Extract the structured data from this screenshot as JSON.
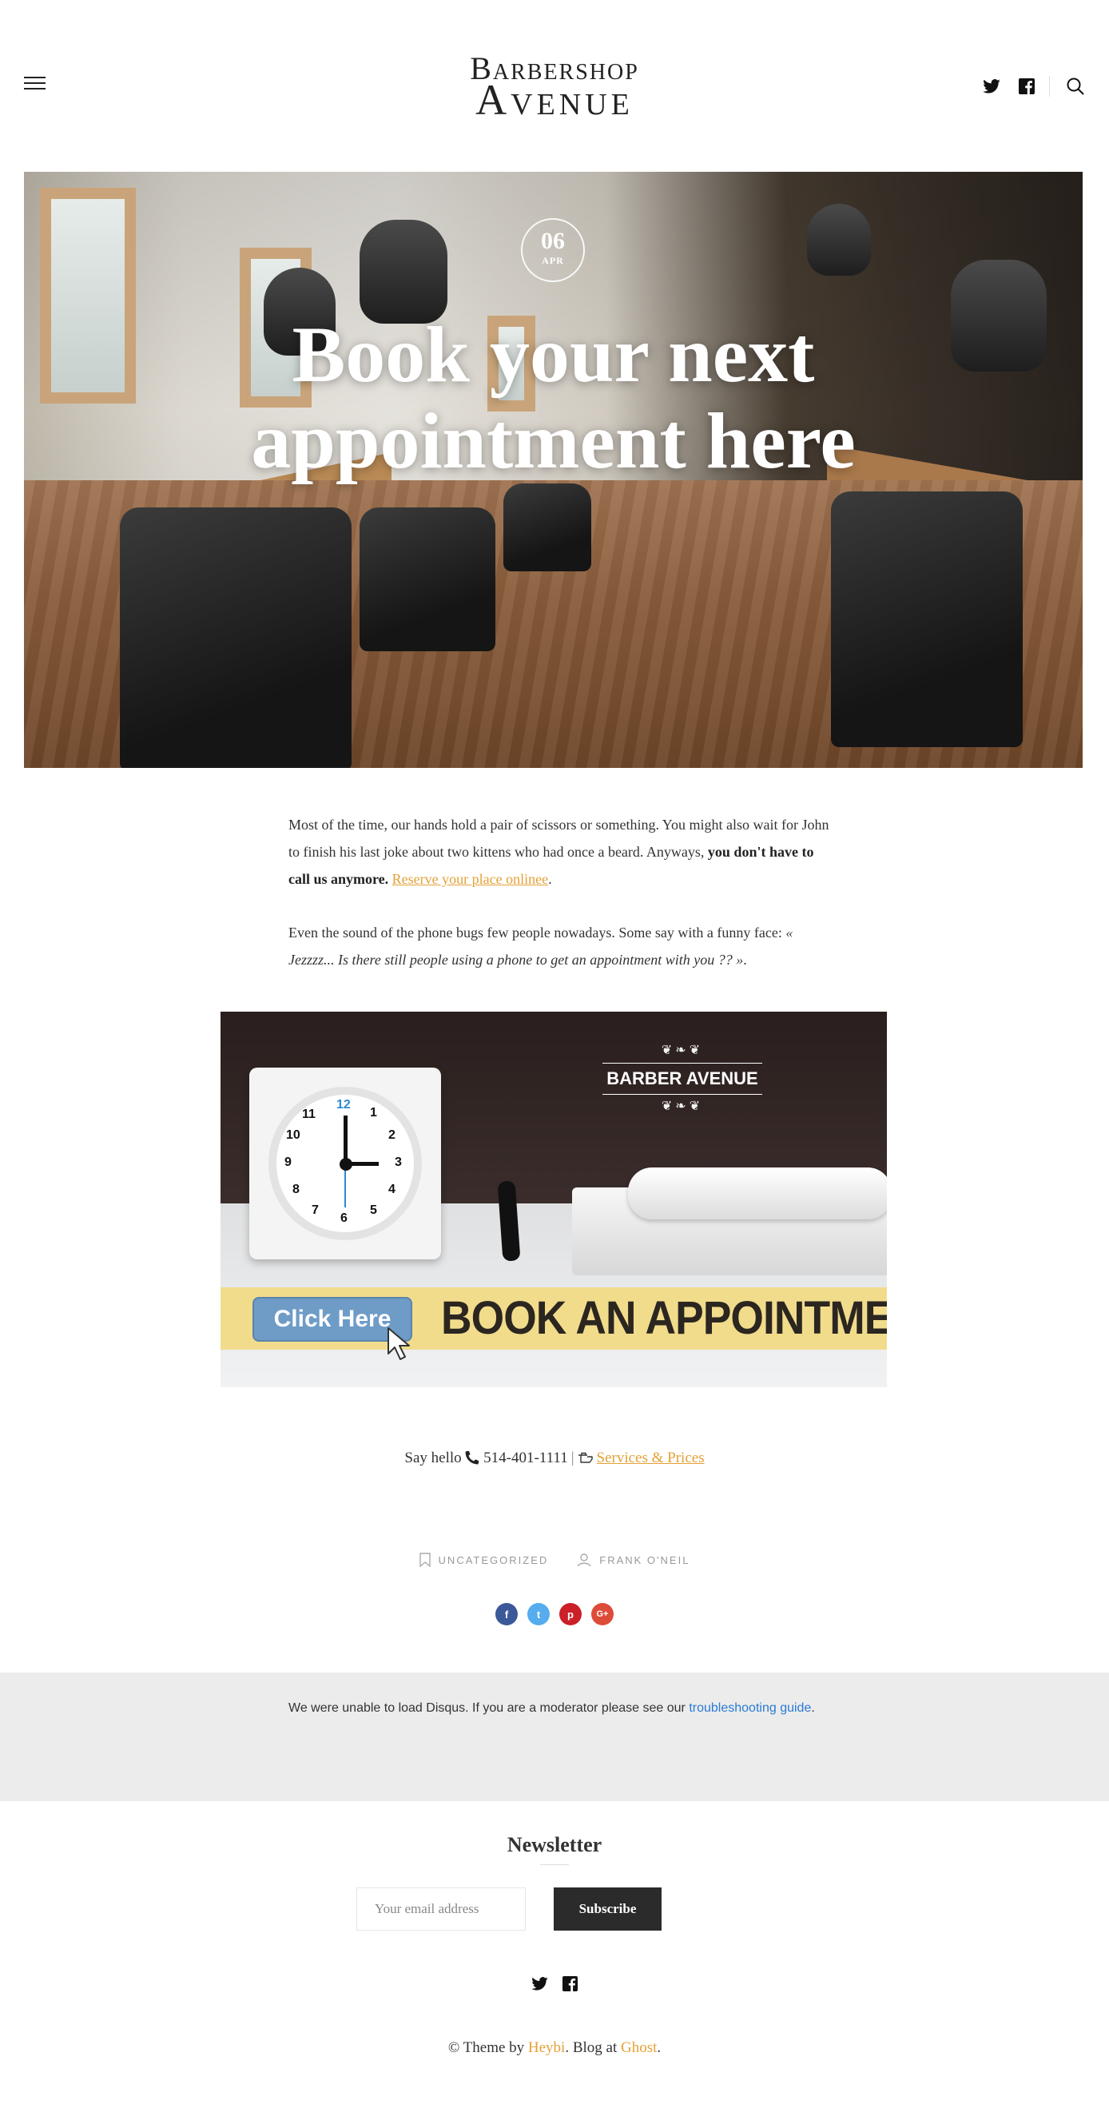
{
  "header": {
    "logo_line1": "Barbershop",
    "logo_line2": "Avenue",
    "icons": [
      "menu-icon",
      "twitter-icon",
      "facebook-icon",
      "search-icon"
    ]
  },
  "hero": {
    "date_day": "06",
    "date_month": "APR",
    "title": "Book your next appointment here"
  },
  "article": {
    "p1_text1": "Most of the time, our hands hold a pair of scissors or something. You might also wait for John to finish his last joke about two kittens who had once a beard. Anyways, ",
    "p1_bold": "you don't have to call us anymore.",
    "p1_link": "Reserve your place onlinee",
    "p1_end": ".",
    "p2_text1": "Even the sound of the phone bugs few people nowadays. Some say with a funny face: ",
    "p2_italic": "« Jezzzz... Is there still people using a phone to get an appointment with you ?? »",
    "p2_end": "."
  },
  "banner": {
    "logo_text": "BARBER AVENUE",
    "clock_numbers": [
      "12",
      "1",
      "2",
      "3",
      "4",
      "5",
      "6",
      "7",
      "8",
      "9",
      "10",
      "11"
    ],
    "click_label": "Click Here",
    "headline": "BOOK AN APPOINTMENT"
  },
  "contact": {
    "say_hello": "Say hello",
    "phone": "514-401-1111",
    "separator": "|",
    "services_link": "Services & Prices"
  },
  "meta": {
    "category": "UNCATEGORIZED",
    "author": "FRANK O'NEIL"
  },
  "share": {
    "facebook": "f",
    "twitter": "t",
    "pinterest": "p",
    "google": "G+",
    "colors": {
      "facebook": "#3b5998",
      "twitter": "#55acee",
      "pinterest": "#cb2027",
      "google": "#dd4b39"
    }
  },
  "disqus": {
    "message": "We were unable to load Disqus. If you are a moderator please see our ",
    "link": "troubleshooting guide",
    "end": "."
  },
  "newsletter": {
    "title": "Newsletter",
    "placeholder": "Your email address",
    "button": "Subscribe"
  },
  "footer": {
    "theme_by": "© Theme by ",
    "heybi": "Heybi",
    "blog_at": ". Blog at ",
    "ghost": "Ghost",
    "end": "."
  },
  "colors": {
    "accent": "#e4a137",
    "dark": "#2b2b2b",
    "link_blue": "#2a7bd2"
  }
}
